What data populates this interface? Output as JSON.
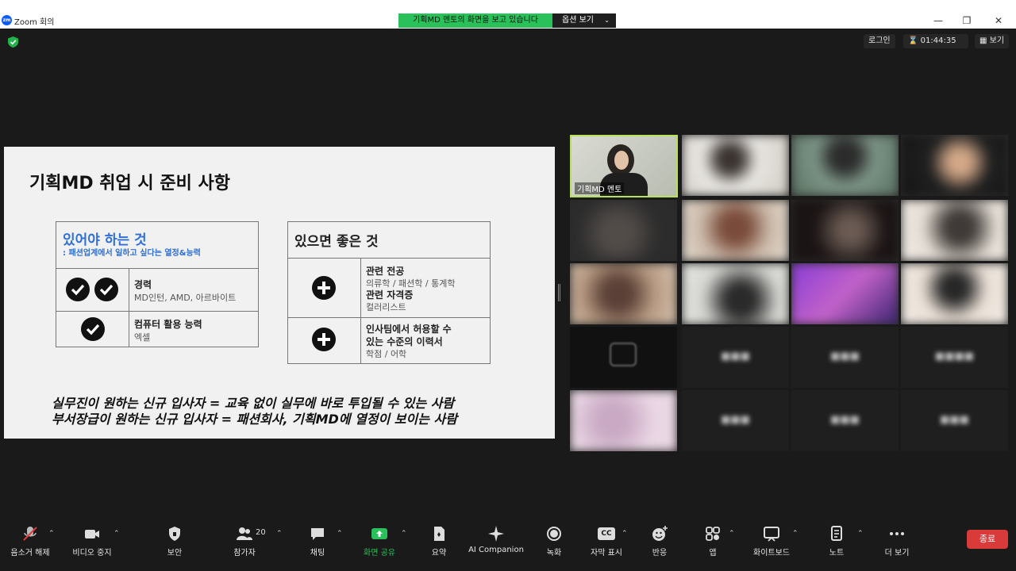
{
  "window": {
    "title": "Zoom 회의",
    "logo_text": "zm",
    "share_banner": "기획MD 멘토의 화면을 보고 있습니다",
    "view_options": "옵션 보기"
  },
  "top": {
    "login": "로그인",
    "timer": "01:44:35",
    "view": "보기"
  },
  "slide": {
    "title": "기획MD 취업 시 준비 사항",
    "must": {
      "heading": "있어야 하는 것",
      "subheading": ": 패션업계에서 일하고 싶다는 열정&능력",
      "items": [
        {
          "title": "경력",
          "sub": "MD인턴, AMD, 아르바이트"
        },
        {
          "title": "컴퓨터 활용 능력",
          "sub": "엑셀"
        }
      ]
    },
    "nice": {
      "heading": "있으면 좋은 것",
      "items": [
        {
          "title": "관련 전공",
          "sub": "의류학 / 패션학 / 통계학",
          "title2": "관련 자격증",
          "sub2": "컬러리스트"
        },
        {
          "title": "인사팀에서 허용할 수",
          "title_b": "있는 수준의 이력서",
          "sub": "학점 / 어학"
        }
      ]
    },
    "line1": "실무진이 원하는 신규 입사자 = 교육 없이 실무에 바로 투입될 수 있는 사람",
    "line2": "부서장급이 원하는 신규 입사자 = 패션회사, 기획MD에 열정이 보이는 사람"
  },
  "gallery": {
    "active_name": "기획MD 멘토"
  },
  "toolbar": {
    "mute": "음소거 해제",
    "video": "비디오 중지",
    "security": "보안",
    "participants": "참가자",
    "participants_count": "20",
    "chat": "채팅",
    "share": "화면 공유",
    "summary": "요약",
    "ai": "AI Companion",
    "record": "녹화",
    "captions": "자막 표시",
    "captions_icon": "CC",
    "reactions": "반응",
    "apps": "앱",
    "whiteboard": "화이트보드",
    "notes": "노트",
    "more": "더 보기",
    "end": "종료"
  },
  "colors": {
    "share_green": "#2ac15a",
    "accent_blue": "#2f6fd6",
    "end_red": "#d93a3a",
    "active_border": "#b9e05a"
  }
}
